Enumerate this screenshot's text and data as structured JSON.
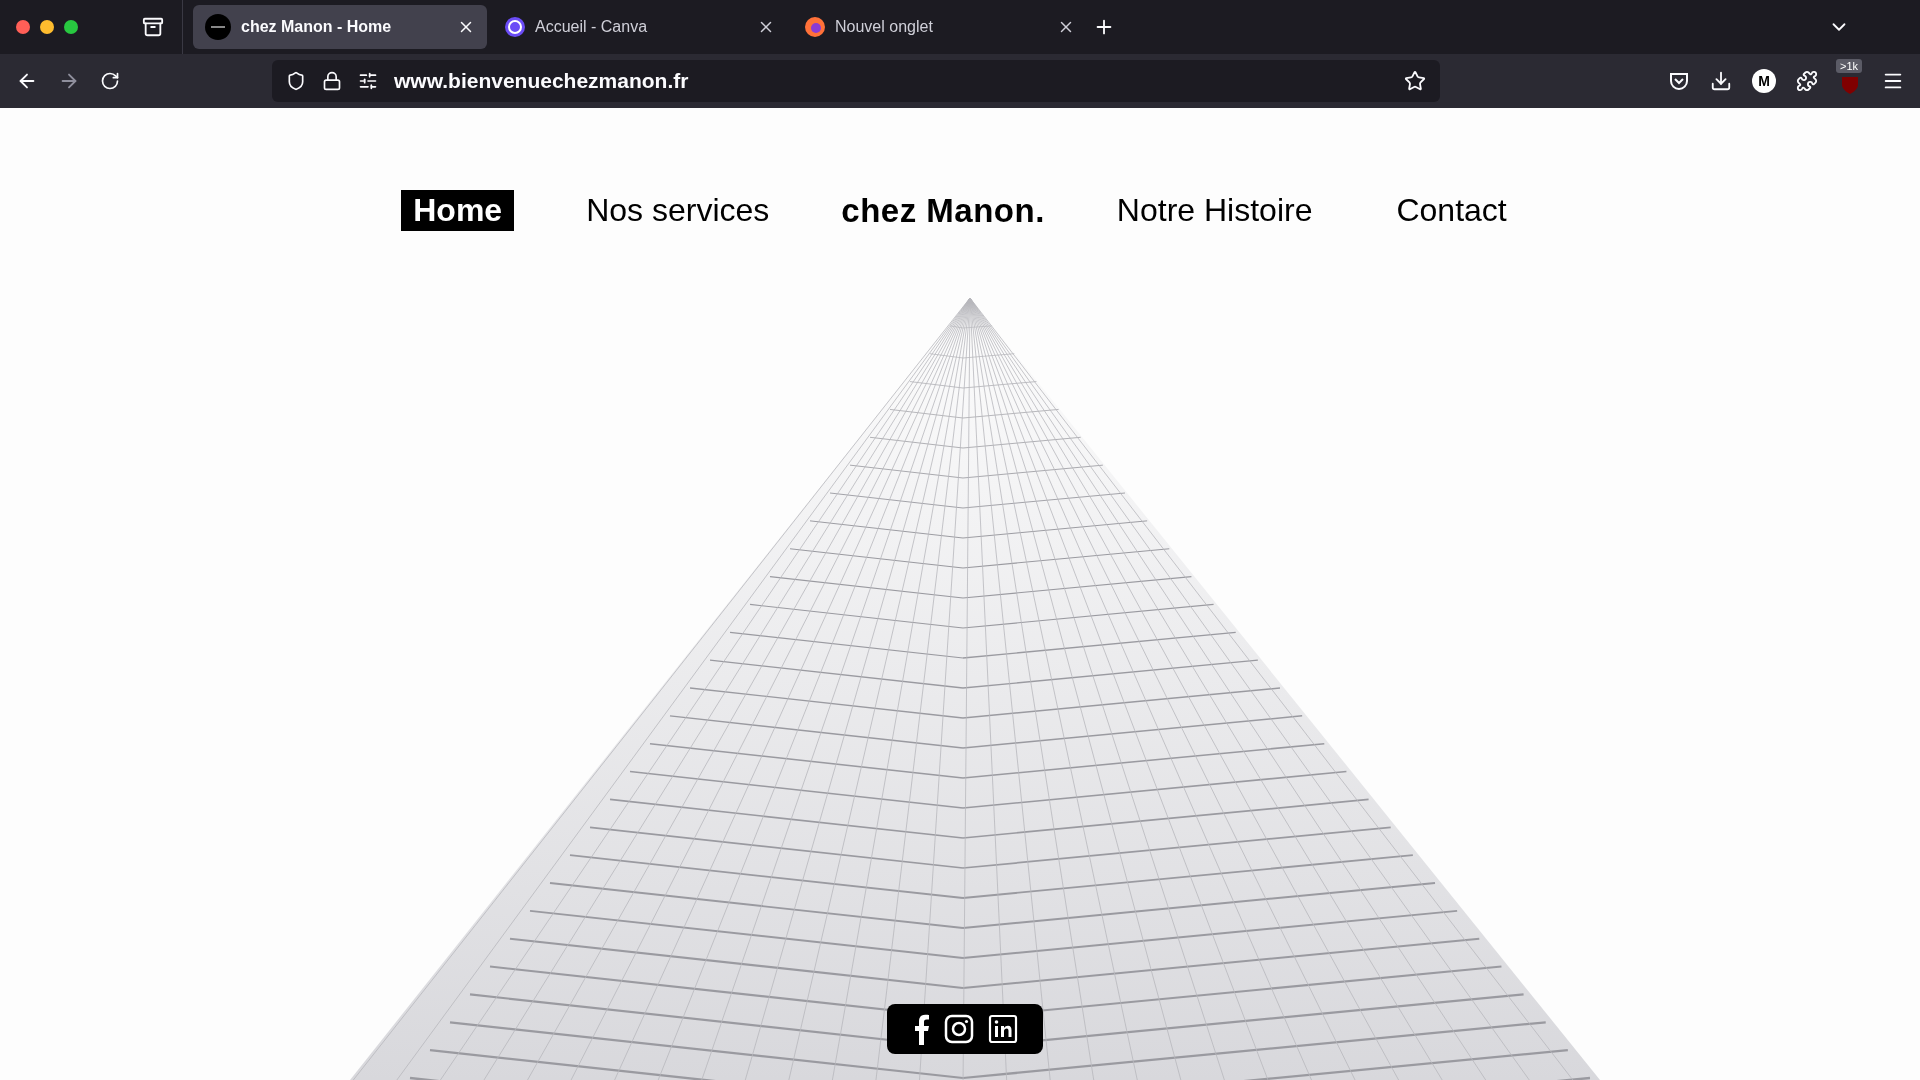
{
  "browser": {
    "tabs": [
      {
        "title": "chez Manon - Home",
        "selected": true
      },
      {
        "title": "Accueil - Canva",
        "selected": false
      },
      {
        "title": "Nouvel onglet",
        "selected": false
      }
    ],
    "url": "www.bienvenuechezmanon.fr",
    "extension_badge": ">1k",
    "account_initial": "M"
  },
  "nav": [
    {
      "label": "Home",
      "kind": "link",
      "selected": true
    },
    {
      "label": "Nos services",
      "kind": "link",
      "selected": false
    },
    {
      "label": "chez Manon.",
      "kind": "logo",
      "selected": false
    },
    {
      "label": "Notre Histoire",
      "kind": "link",
      "selected": false
    },
    {
      "label": "Contact",
      "kind": "link",
      "selected": false
    }
  ]
}
